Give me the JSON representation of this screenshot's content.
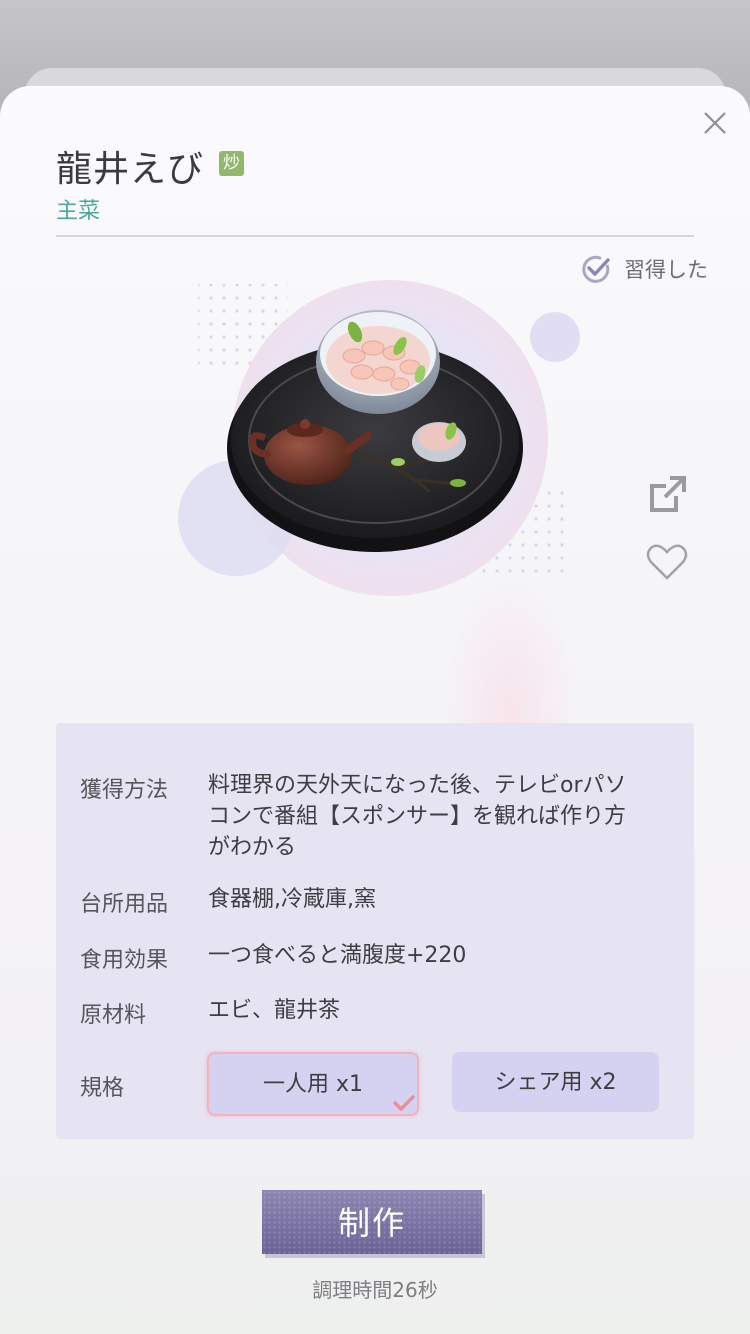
{
  "dish": {
    "title": "龍井えび",
    "method_badge": "炒",
    "category": "主菜",
    "learned_label": "習得した"
  },
  "info": {
    "rows": [
      {
        "label": "獲得方法",
        "value_lines": [
          "料理界の天外天になった後、テレビorパソ",
          "コンで番組【スポンサー】を観れば作り方",
          "がわかる"
        ]
      },
      {
        "label": "台所用品",
        "value": "食器棚,冷蔵庫,窯"
      },
      {
        "label": "食用効果",
        "value": "一つ食べると満腹度+220"
      },
      {
        "label": "原材料",
        "value": "エビ、龍井茶"
      }
    ],
    "spec_label": "規格",
    "spec_options": [
      {
        "label": "一人用 x1",
        "selected": true
      },
      {
        "label": "シェア用 x2",
        "selected": false
      }
    ]
  },
  "actions": {
    "make_label": "制作",
    "cook_time": "調理時間26秒"
  },
  "icons": {
    "close": "close-icon",
    "learned": "check-circle-icon",
    "share": "share-icon",
    "favorite": "heart-icon"
  },
  "colors": {
    "accent_purple": "#7a72a3",
    "category_teal": "#4aa7a0",
    "badge_green": "#92b86c",
    "info_bg": "#e6e4f2",
    "spec_btn_bg": "#d5d1f0",
    "selected_border": "#f1b4bc"
  }
}
